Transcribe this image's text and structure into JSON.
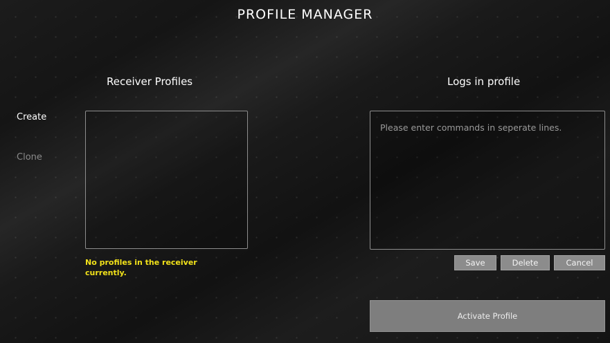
{
  "title": "PROFILE MANAGER",
  "sidebar": {
    "create_label": "Create",
    "clone_label": "Clone"
  },
  "receiver_profiles": {
    "heading": "Receiver Profiles",
    "items": [],
    "empty_message": "No profiles in the receiver currently."
  },
  "logs_in_profile": {
    "heading": "Logs in profile",
    "placeholder": "Please enter commands in seperate lines.",
    "value": ""
  },
  "actions": {
    "save_label": "Save",
    "delete_label": "Delete",
    "cancel_label": "Cancel",
    "activate_label": "Activate Profile"
  },
  "colors": {
    "background": "#151515",
    "warning_text": "#f2e21a",
    "button_bg": "#8c8c8c",
    "activate_bg": "#7e7e7e",
    "border": "#8e8e8e"
  }
}
